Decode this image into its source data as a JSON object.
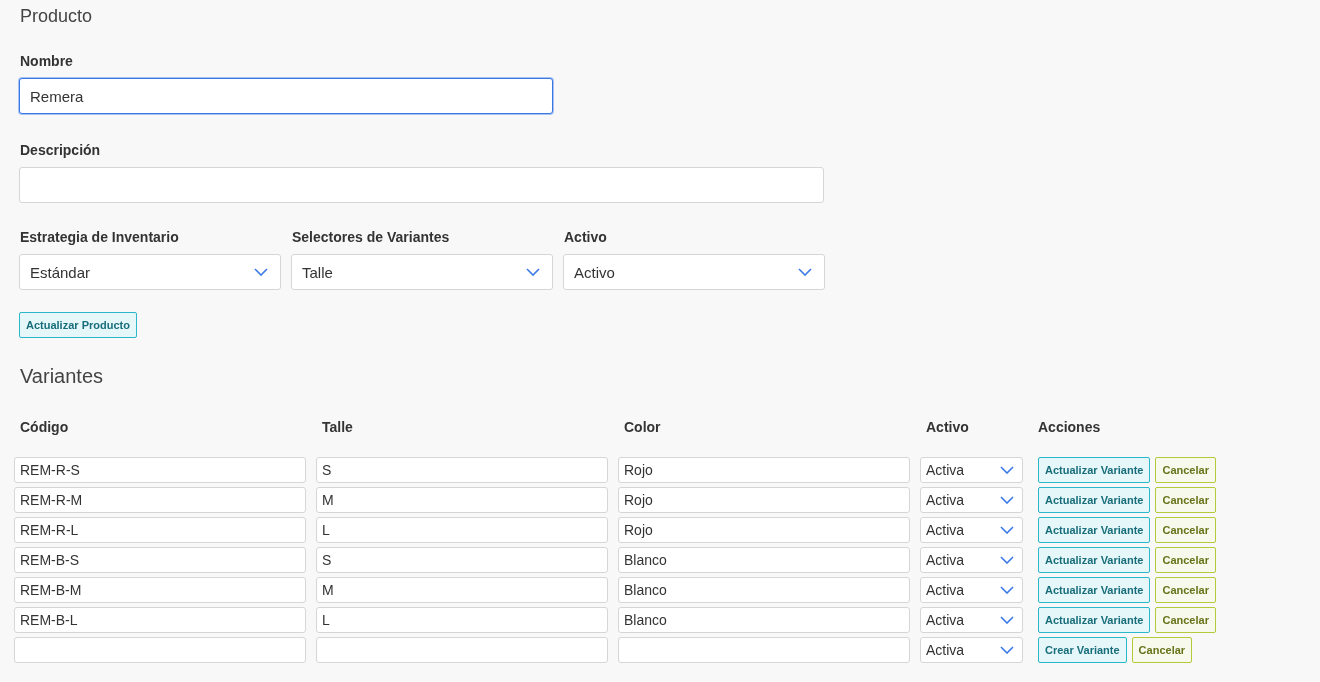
{
  "product": {
    "title": "Producto",
    "name": {
      "label": "Nombre",
      "value": "Remera",
      "focused": true
    },
    "description": {
      "label": "Descripción",
      "focused": false
    },
    "selects": [
      {
        "label": "Estrategia de Inventario",
        "value": "Estándar"
      },
      {
        "label": "Selectores de Variantes",
        "value": "Talle"
      },
      {
        "label": "Activo",
        "value": "Activo"
      }
    ],
    "button": "Actualizar Producto"
  },
  "variants": {
    "title": "Variantes",
    "columns": [
      "Código",
      "Talle",
      "Color",
      "Activo",
      "Acciones"
    ],
    "rows": [
      {
        "cells": [
          "REM-R-S",
          "S",
          "Rojo"
        ],
        "active": "Activa",
        "actions": [
          {
            "kind": "primary",
            "label": "Actualizar Variante"
          },
          {
            "kind": "cancel",
            "label": "Cancelar"
          }
        ]
      },
      {
        "cells": [
          "REM-R-M",
          "M",
          "Rojo"
        ],
        "active": "Activa",
        "actions": [
          {
            "kind": "primary",
            "label": "Actualizar Variante"
          },
          {
            "kind": "cancel",
            "label": "Cancelar"
          }
        ]
      },
      {
        "cells": [
          "REM-R-L",
          "L",
          "Rojo"
        ],
        "active": "Activa",
        "actions": [
          {
            "kind": "primary",
            "label": "Actualizar Variante"
          },
          {
            "kind": "cancel",
            "label": "Cancelar"
          }
        ]
      },
      {
        "cells": [
          "REM-B-S",
          "S",
          "Blanco"
        ],
        "active": "Activa",
        "actions": [
          {
            "kind": "primary",
            "label": "Actualizar Variante"
          },
          {
            "kind": "cancel",
            "label": "Cancelar"
          }
        ]
      },
      {
        "cells": [
          "REM-B-M",
          "M",
          "Blanco"
        ],
        "active": "Activa",
        "actions": [
          {
            "kind": "primary",
            "label": "Actualizar Variante"
          },
          {
            "kind": "cancel",
            "label": "Cancelar"
          }
        ]
      },
      {
        "cells": [
          "REM-B-L",
          "L",
          "Blanco"
        ],
        "active": "Activa",
        "actions": [
          {
            "kind": "primary",
            "label": "Actualizar Variante"
          },
          {
            "kind": "cancel",
            "label": "Cancelar"
          }
        ]
      },
      {
        "active": "Activa",
        "actions": [
          {
            "kind": "primary",
            "label": "Crear Variante"
          },
          {
            "kind": "cancel",
            "label": "Cancelar"
          }
        ]
      }
    ]
  }
}
